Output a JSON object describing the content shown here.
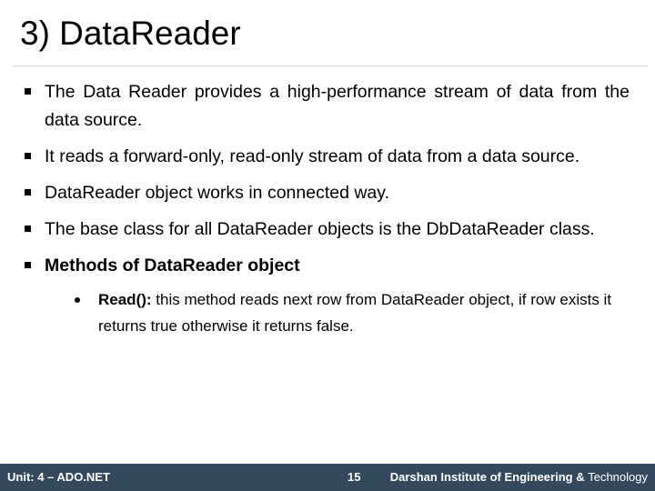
{
  "slide": {
    "title": "3) DataReader",
    "bullets": [
      {
        "text": "The Data Reader provides a high-performance stream of data from the data source.",
        "bold": false
      },
      {
        "text": "It reads a forward-only, read-only stream of data from a data source.",
        "bold": false
      },
      {
        "text": "DataReader object works in connected way.",
        "bold": false
      },
      {
        "text": "The base class for all DataReader objects is the DbDataReader class.",
        "bold": false
      },
      {
        "text": "Methods of DataReader object",
        "bold": true
      }
    ],
    "sub_bullets": [
      {
        "term": "Read():",
        "description": " this method reads next row from DataReader object, if row exists it returns true otherwise it returns false."
      }
    ]
  },
  "footer": {
    "unit": "Unit: 4 – ADO.NET",
    "page_number": "15",
    "institute_bold": "Darshan Institute of Engineering & ",
    "institute_regular": "Technology",
    "background_color": "#34495e"
  }
}
